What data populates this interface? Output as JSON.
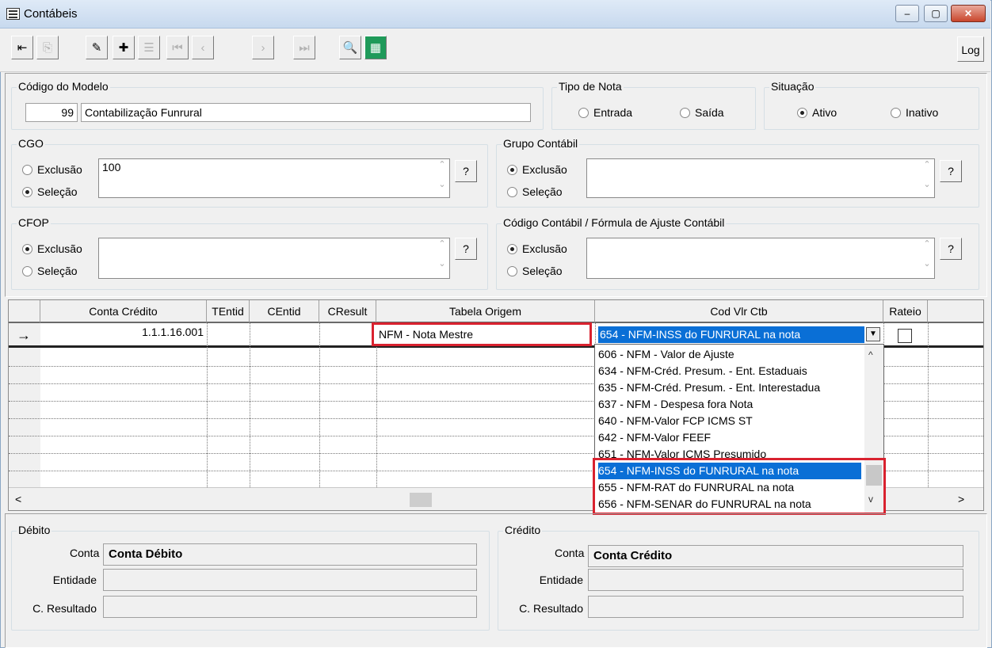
{
  "window": {
    "title": "Contábeis",
    "min": "–",
    "max": "▢",
    "close": "✕"
  },
  "toolbar": {
    "log": "Log",
    "buttons": [
      "exit",
      "insert",
      "edit",
      "new-record",
      "delete",
      "first",
      "prev",
      "next",
      "last",
      "search",
      "grid"
    ]
  },
  "modelo": {
    "label": "Código do Modelo",
    "code": "99",
    "name": "Contabilização Funrural"
  },
  "tipo_nota": {
    "label": "Tipo de Nota",
    "entrada": "Entrada",
    "saida": "Saída"
  },
  "situacao": {
    "label": "Situação",
    "ativo": "Ativo",
    "inativo": "Inativo"
  },
  "cgo": {
    "label": "CGO",
    "exclusao": "Exclusão",
    "selecao": "Seleção",
    "value": "100",
    "help": "?"
  },
  "grupo": {
    "label": "Grupo Contábil",
    "exclusao": "Exclusão",
    "selecao": "Seleção",
    "help": "?"
  },
  "cfop": {
    "label": "CFOP",
    "exclusao": "Exclusão",
    "selecao": "Seleção",
    "help": "?"
  },
  "codigo_contabil": {
    "label": "Código Contábil / Fórmula de Ajuste Contábil",
    "exclusao": "Exclusão",
    "selecao": "Seleção",
    "help": "?"
  },
  "grid": {
    "headers": [
      "Conta Crédito",
      "TEntid",
      "CEntid",
      "CResult",
      "Tabela Origem",
      "Cod Vlr Ctb",
      "Rateio"
    ],
    "row": {
      "indicator": "→",
      "conta_credito": "1.1.1.16.001",
      "tabela_origem": "NFM - Nota Mestre",
      "cod_vlr": "654 - NFM-INSS do FUNRURAL na nota"
    },
    "scroll_left": "<",
    "scroll_right": ">"
  },
  "dropdown": {
    "items": [
      "606 - NFM - Valor de Ajuste",
      "634 - NFM-Créd. Presum. - Ent. Estaduais",
      "635 - NFM-Créd. Presum. - Ent. Interestadua",
      "637 - NFM - Despesa fora Nota",
      "640 - NFM-Valor FCP ICMS ST",
      "642 - NFM-Valor FEEF",
      "651 - NFM-Valor ICMS Presumido",
      "654 - NFM-INSS do FUNRURAL na nota",
      "655 - NFM-RAT do FUNRURAL na nota",
      "656 - NFM-SENAR do FUNRURAL na nota"
    ]
  },
  "debito": {
    "label": "Débito",
    "conta": "Conta",
    "entidade": "Entidade",
    "cresult": "C. Resultado",
    "conta_value": "Conta Débito"
  },
  "credito": {
    "label": "Crédito",
    "conta": "Conta",
    "entidade": "Entidade",
    "cresult": "C. Resultado",
    "conta_value": "Conta Crédito"
  },
  "colors": {
    "selection": "#0a6fd6",
    "highlight_border": "#d9222f"
  }
}
